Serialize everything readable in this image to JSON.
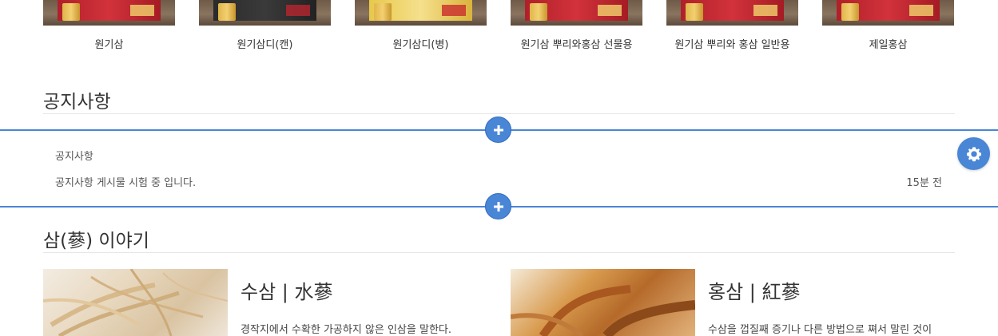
{
  "products": [
    {
      "name": "원기삼",
      "style": "red"
    },
    {
      "name": "원기삼디(캔)",
      "style": "dark"
    },
    {
      "name": "원기삼디(병)",
      "style": "yellow"
    },
    {
      "name": "원기삼 뿌리와홍삼 선물용",
      "style": "red"
    },
    {
      "name": "원기삼 뿌리와 홍삼 일반용",
      "style": "red"
    },
    {
      "name": "제일홍삼",
      "style": "red"
    }
  ],
  "notice": {
    "title": "공지사항",
    "category": "공지사항",
    "post_title": "공지사항 게시물 시험 중 입니다.",
    "post_time": "15분 전"
  },
  "story": {
    "title": "삼(蔘) 이야기",
    "items": [
      {
        "title": "수삼 | 水蔘",
        "desc": "경작지에서 수확한 가공하지 않은 인삼을 말한다."
      },
      {
        "title": "홍삼 | 紅蔘",
        "desc": "수삼을 껍질째 증기나 다른 방법으로 쪄서 말린 것이"
      }
    ]
  },
  "colors": {
    "accent": "#4a86d6",
    "text": "#333333",
    "rule": "#e6e6e6"
  },
  "icons": {
    "add": "plus-icon",
    "settings": "gear-icon"
  }
}
